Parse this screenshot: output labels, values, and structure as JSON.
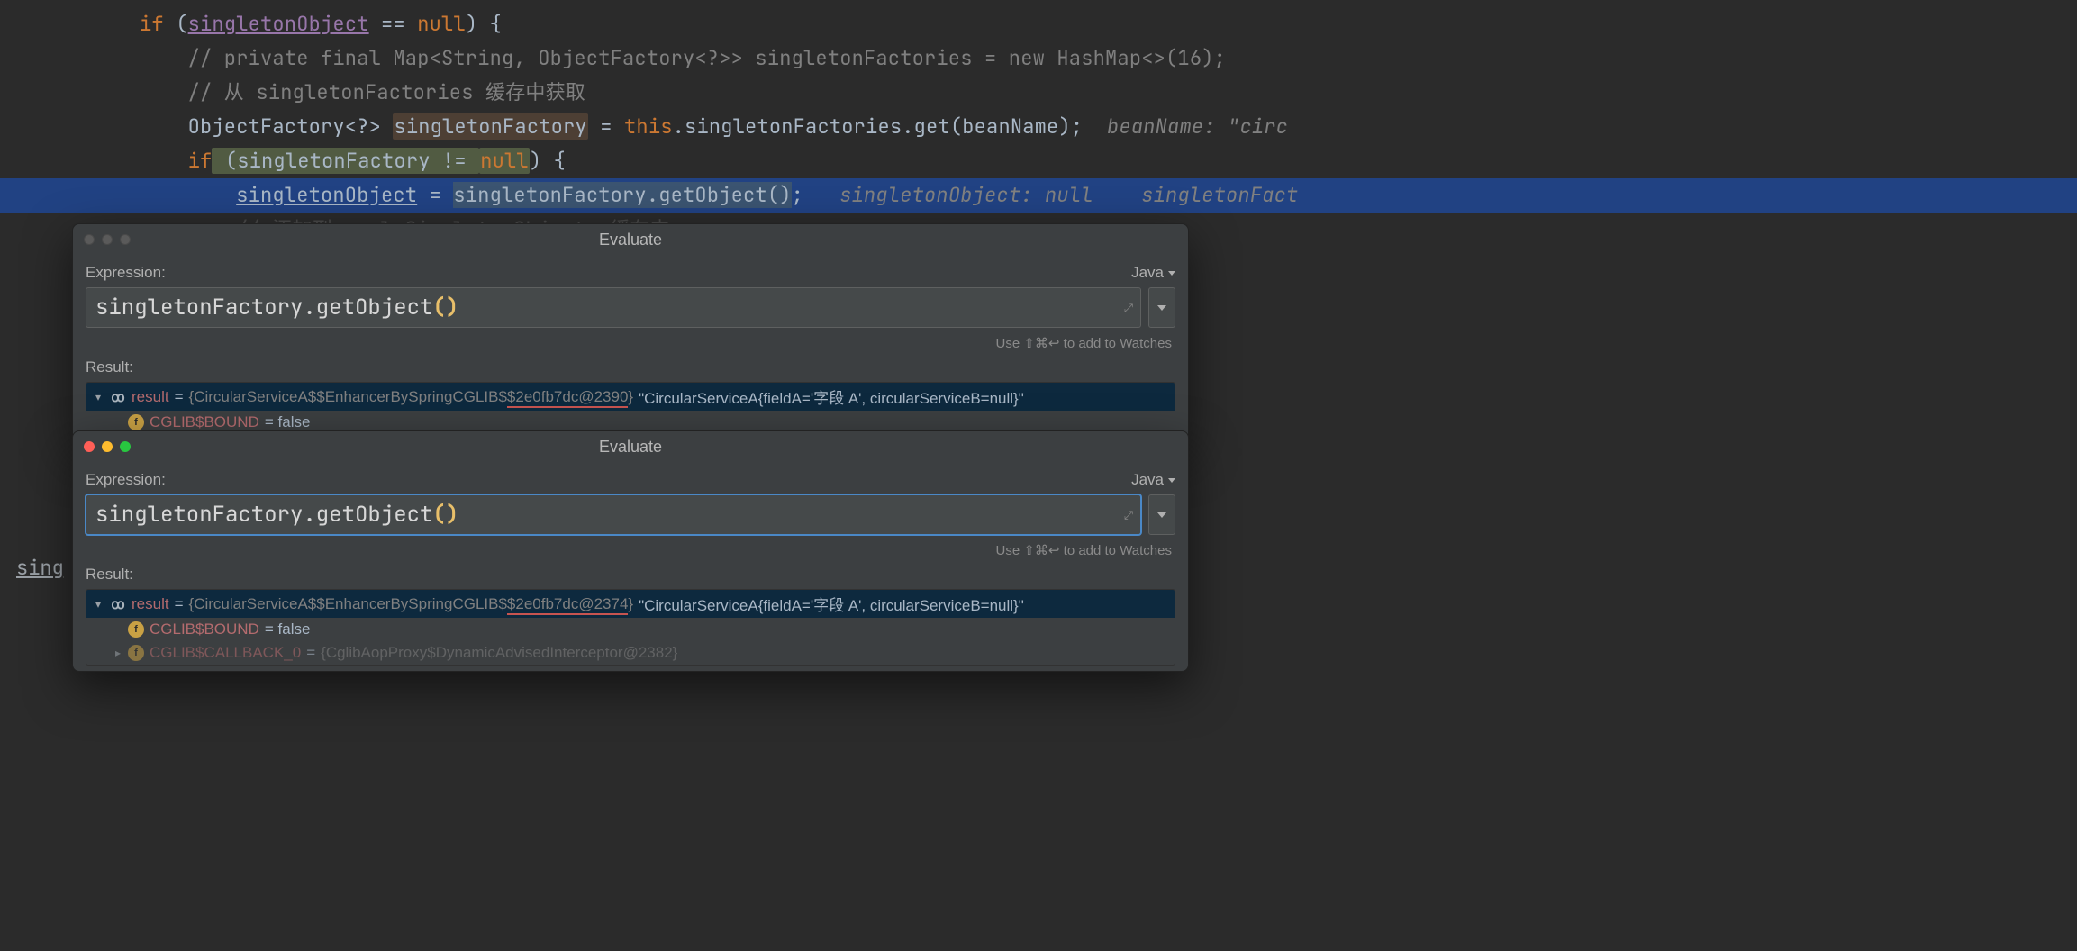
{
  "code": {
    "l1_if": "if",
    "l1_obj": "singletonObject",
    "l1_rest": " == ",
    "l1_null": "null",
    "l1_close": ") {",
    "l2": "// private final Map<String, ObjectFactory<?>> singletonFactories = new HashMap<>(16);",
    "l3": "// 从 singletonFactories 缓存中获取",
    "l4_type": "ObjectFactory<?> ",
    "l4_var": "singletonFactory",
    "l4_mid": " = ",
    "l4_this": "this",
    "l4_call": ".singletonFactories.get(beanName);",
    "l4_hint": "  beanName: \"circ",
    "l5_if": "if",
    "l5_open": " (singletonFactory != ",
    "l5_null": "null",
    "l5_close": ") {",
    "l6_var": "singletonObject",
    "l6_mid": " = ",
    "l6_call": "singletonFactory.getObject()",
    "l6_semi": ";",
    "l6_hint1": "   singletonObject: null",
    "l6_hint2": "    singletonFact",
    "l7": "}",
    "bottom_fragment": "sing"
  },
  "dialog1": {
    "title": "Evaluate",
    "exprLabel": "Expression:",
    "lang": "Java",
    "expr_pre": "singletonFactory.getObject",
    "expr_par": "()",
    "hint": "Use ⇧⌘↩ to add to Watches",
    "resultLabel": "Result:",
    "row1_name": "result",
    "row1_eq": " = ",
    "row1_type_a": "{CircularServiceA$$EnhancerBySpringCGLIB$",
    "row1_type_b": "$2e0fb7dc@2390",
    "row1_type_c": "}",
    "row1_val": " \"CircularServiceA{fieldA='字段 A', circularServiceB=null}\"",
    "row2_name": "CGLIB$BOUND",
    "row2_val": " = false"
  },
  "dialog2": {
    "title": "Evaluate",
    "exprLabel": "Expression:",
    "lang": "Java",
    "expr_pre": "singletonFactory.getObject",
    "expr_par": "()",
    "hint": "Use ⇧⌘↩ to add to Watches",
    "resultLabel": "Result:",
    "row1_name": "result",
    "row1_eq": " = ",
    "row1_type_a": "{CircularServiceA$$EnhancerBySpringCGLIB$",
    "row1_type_b": "$2e0fb7dc@2374",
    "row1_type_c": "}",
    "row1_val": " \"CircularServiceA{fieldA='字段 A', circularServiceB=null}\"",
    "row2_name": "CGLIB$BOUND",
    "row2_val": " = false",
    "row3_name": "CGLIB$CALLBACK_0",
    "row3_eq": " = ",
    "row3_type": "{CglibAopProxy$DynamicAdvisedInterceptor@2382}"
  }
}
